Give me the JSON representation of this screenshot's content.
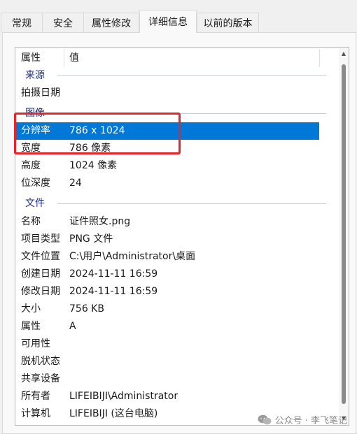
{
  "tabs": [
    "常规",
    "安全",
    "属性修改",
    "详细信息",
    "以前的版本"
  ],
  "active_tab": 3,
  "header": {
    "col1": "属性",
    "col2": "值"
  },
  "groups": {
    "source": "来源",
    "image": "图像",
    "file": "文件"
  },
  "rows": {
    "shoot_date": {
      "key": "拍摄日期",
      "value": ""
    },
    "resolution": {
      "key": "分辨率",
      "value": "786 x 1024"
    },
    "width": {
      "key": "宽度",
      "value": "786 像素"
    },
    "height": {
      "key": "高度",
      "value": "1024 像素"
    },
    "bit_depth": {
      "key": "位深度",
      "value": "24"
    },
    "name": {
      "key": "名称",
      "value": "证件照女.png"
    },
    "type": {
      "key": "项目类型",
      "value": "PNG 文件"
    },
    "location": {
      "key": "文件位置",
      "value": "C:\\用户\\Administrator\\桌面"
    },
    "created": {
      "key": "创建日期",
      "value": "2024-11-11 16:59"
    },
    "modified": {
      "key": "修改日期",
      "value": "2024-11-11 16:59"
    },
    "size": {
      "key": "大小",
      "value": "756 KB"
    },
    "attributes": {
      "key": "属性",
      "value": "A"
    },
    "availability": {
      "key": "可用性",
      "value": ""
    },
    "offline": {
      "key": "脱机状态",
      "value": ""
    },
    "shared": {
      "key": "共享设备",
      "value": ""
    },
    "owner": {
      "key": "所有者",
      "value": "LIFEIBIJI\\Administrator"
    },
    "computer": {
      "key": "计算机",
      "value": "LIFEIBIJI (这台电脑)"
    }
  },
  "selected_row": "resolution",
  "watermark": {
    "icon": "wechat-icon",
    "text": "公众号 · 李飞笔记"
  },
  "colors": {
    "selection": "#0078d7",
    "group_label": "#1e3287",
    "annotation": "#e8242a"
  }
}
